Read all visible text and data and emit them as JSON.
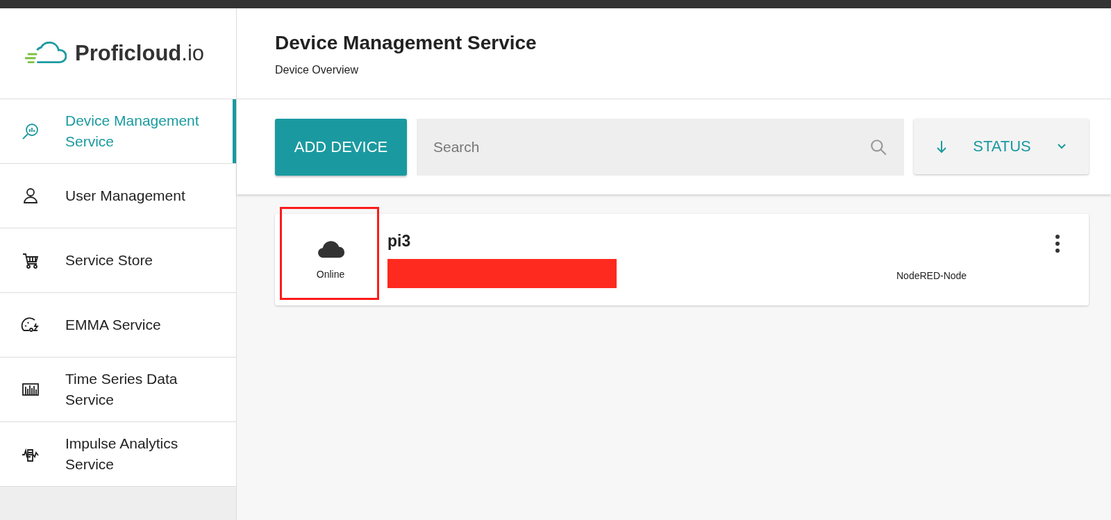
{
  "logo": {
    "text": "**Proficloud**.io"
  },
  "sidebar": {
    "items": [
      {
        "label": "Device Management Service",
        "kind": "device",
        "selected": true
      },
      {
        "label": "User Management",
        "kind": "user",
        "selected": false
      },
      {
        "label": "Service Store",
        "kind": "cart",
        "selected": false
      },
      {
        "label": "EMMA Service",
        "kind": "gauge",
        "selected": false
      },
      {
        "label": "Time Series Data Service",
        "kind": "bars",
        "selected": false
      },
      {
        "label": "Impulse Analytics Service",
        "kind": "impulse",
        "selected": false
      }
    ]
  },
  "header": {
    "title": "Device Management Service",
    "subtitle": "Device Overview"
  },
  "toolbar": {
    "add_button": "ADD DEVICE",
    "search": {
      "placeholder": "Search"
    },
    "sort": {
      "label": "STATUS"
    }
  },
  "devices": [
    {
      "name": "pi3",
      "status": "Online",
      "type": "NodeRED-Node"
    }
  ]
}
